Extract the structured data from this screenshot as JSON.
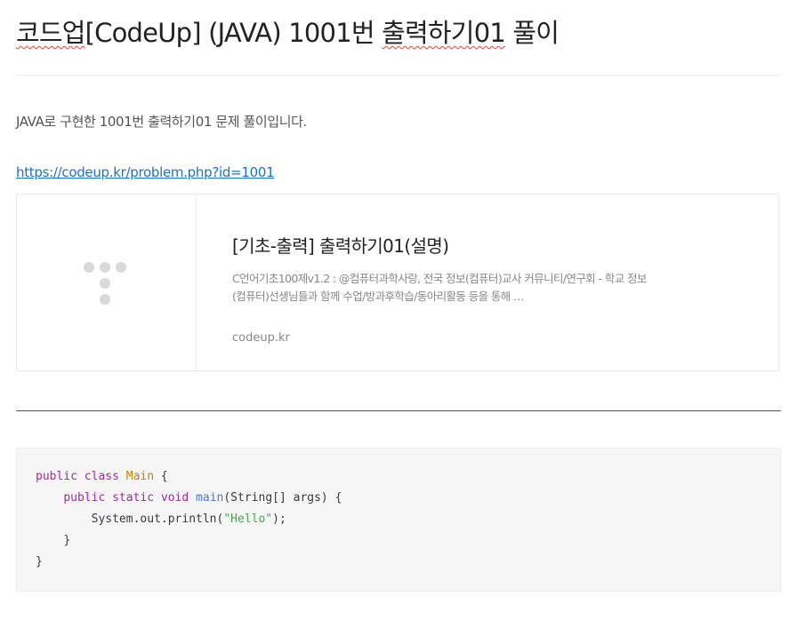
{
  "post": {
    "title_prefix": "코드업",
    "title_middle": "[CodeUp] (JAVA) 1001번 ",
    "title_squiggle": "출력하기01",
    "title_suffix": " 풀이",
    "intro": "JAVA로 구현한 1001번 출력하기01 문제 풀이입니다.",
    "link_text": "https://codeup.kr/problem.php?id=1001"
  },
  "card": {
    "title": "[기초-출력] 출력하기01(설명)",
    "description": "C언어기초100제v1.2 : @컴퓨터과학사랑, 전국 정보(컴퓨터)교사 커뮤니티/연구회 - 학교 정보(컴퓨터)선생님들과 함께 수업/방과후학습/동아리활동 등을 통해 …",
    "domain": "codeup.kr",
    "logo_icon": "codeup-dots-logo-icon",
    "logo_color": "#d9d9d9"
  },
  "code": {
    "language": "java",
    "colors": {
      "keyword": "#a626a4",
      "class": "#c18401",
      "function": "#4078f2",
      "string": "#50a14f",
      "text": "#383a42"
    },
    "tokens": {
      "public": "public",
      "class": "class",
      "class_name": "Main",
      "open_brace": " {",
      "static": "static",
      "void": "void",
      "main": "main",
      "main_args": "(String[] args) {",
      "println_call": "System.out.println(",
      "hello": "\"Hello\"",
      "call_end": ");",
      "inner_close": "}",
      "outer_close": "}"
    }
  }
}
